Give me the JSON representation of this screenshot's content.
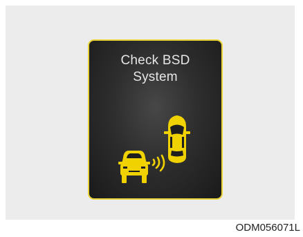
{
  "warning": {
    "title_line1": "Check BSD",
    "title_line2": "System",
    "accent_color": "#e9d335",
    "icon": "blind-spot-detection-icon"
  },
  "caption": {
    "code": "ODM056071L"
  }
}
